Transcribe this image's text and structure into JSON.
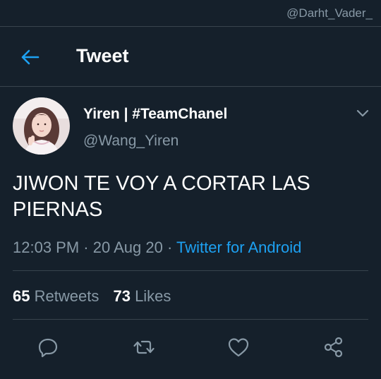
{
  "watermark": "@Darht_Vader_",
  "header": {
    "back_icon": "arrow-left-icon",
    "title": "Tweet"
  },
  "tweet": {
    "display_name": "Yiren | #TeamChanel",
    "handle": "@Wang_Yiren",
    "text": "JIWON TE VOY A CORTAR LAS PIERNAS",
    "time": "12:03 PM",
    "sep1": "·",
    "date": "20 Aug 20",
    "sep2": "·",
    "source": "Twitter for Android"
  },
  "stats": {
    "retweets_count": "65",
    "retweets_label": "Retweets",
    "likes_count": "73",
    "likes_label": "Likes"
  },
  "actions": {
    "reply_icon": "reply-icon",
    "retweet_icon": "retweet-icon",
    "like_icon": "heart-icon",
    "share_icon": "share-icon"
  },
  "colors": {
    "background": "#15202b",
    "accent": "#1da1f2",
    "secondary_text": "#8899a6",
    "divider": "#38444d"
  }
}
